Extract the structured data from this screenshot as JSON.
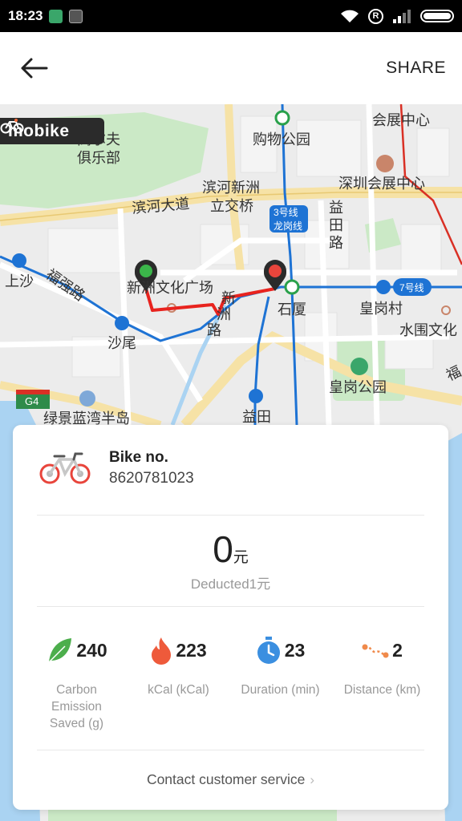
{
  "status_bar": {
    "time": "18:23",
    "r_icon": "R"
  },
  "header": {
    "back_icon": "arrow-left-icon",
    "share_label": "SHARE"
  },
  "map": {
    "brand": "mobike",
    "labels": [
      "会展中心",
      "购物公园",
      "高尔夫",
      "俱乐部",
      "深圳会展中心",
      "滨河新洲",
      "立交桥",
      "滨河大道",
      "3号线",
      "龙岗线",
      "益",
      "田",
      "路",
      "上沙",
      "福强路",
      "新洲文化广场",
      "新",
      "洲",
      "路",
      "石厦",
      "7号线",
      "皇岗村",
      "水围文化",
      "沙尾",
      "皇岗公园",
      "G4",
      "绿景蓝湾半岛",
      "益田",
      "福"
    ]
  },
  "card": {
    "bike_label": "Bike no.",
    "bike_number": "8620781023",
    "amount_value": "0",
    "amount_unit": "元",
    "deducted_text": "Deducted1元",
    "stats": [
      {
        "icon": "leaf-icon",
        "value": "240",
        "label": "Carbon Emission Saved (g)"
      },
      {
        "icon": "flame-icon",
        "value": "223",
        "label": "kCal (kCal)"
      },
      {
        "icon": "stopwatch-icon",
        "value": "23",
        "label": "Duration (min)"
      },
      {
        "icon": "distance-icon",
        "value": "2",
        "label": "Distance (km)"
      }
    ],
    "contact_label": "Contact customer service"
  },
  "colors": {
    "route": "#e8231e",
    "metro_line": "#1e73d4",
    "road_yellow": "#f6e2a6",
    "park_green": "#cbe9c6",
    "water": "#aad3f2"
  }
}
